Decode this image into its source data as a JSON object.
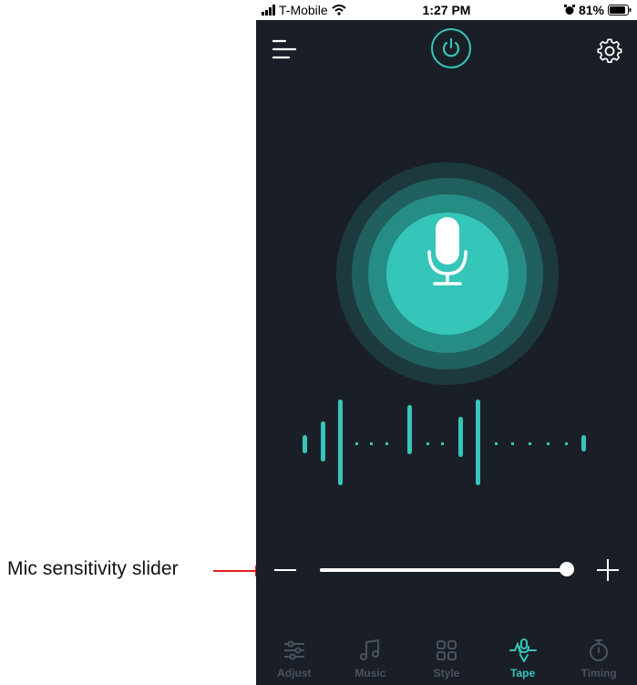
{
  "callout": {
    "label": "Mic sensitivity slider"
  },
  "status_bar": {
    "carrier": "T-Mobile",
    "time": "1:27 PM",
    "battery": "81%"
  },
  "header": {
    "menu_icon": "menu-lines-icon",
    "power_icon": "power-icon",
    "settings_icon": "gear-icon"
  },
  "colors": {
    "accent": "#35c6b9",
    "background": "#1a1f27",
    "inactive": "#4a5260"
  },
  "mic": {
    "icon": "microphone-icon"
  },
  "sensitivity_slider": {
    "value": 0.99,
    "minus_icon": "minus-icon",
    "plus_icon": "plus-icon"
  },
  "tabs": [
    {
      "label": "Adjust",
      "icon": "sliders-icon",
      "active": false
    },
    {
      "label": "Music",
      "icon": "music-note-icon",
      "active": false
    },
    {
      "label": "Style",
      "icon": "grid-icon",
      "active": false
    },
    {
      "label": "Tape",
      "icon": "tape-mic-icon",
      "active": true
    },
    {
      "label": "Timing",
      "icon": "timer-icon",
      "active": false
    }
  ]
}
